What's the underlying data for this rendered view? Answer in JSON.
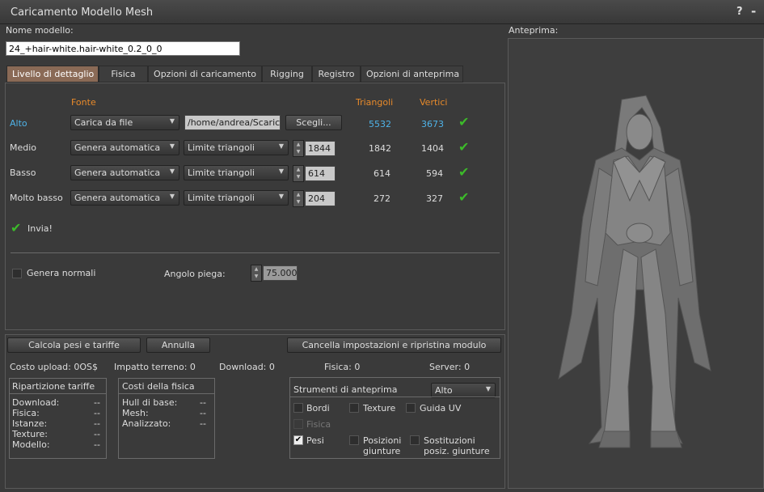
{
  "window": {
    "title": "Caricamento Modello Mesh",
    "help": "?",
    "close": "-"
  },
  "model_name": {
    "label": "Nome modello:",
    "value": "24_+hair-white.hair-white_0.2_0_0"
  },
  "tabs": [
    {
      "label": "Livello di dettaglio",
      "active": true
    },
    {
      "label": "Fisica"
    },
    {
      "label": "Opzioni di caricamento"
    },
    {
      "label": "Rigging"
    },
    {
      "label": "Registro"
    },
    {
      "label": "Opzioni di anteprima"
    }
  ],
  "lod": {
    "headers": {
      "source": "Fonte",
      "triangles": "Triangoli",
      "vertices": "Vertici"
    },
    "rows": [
      {
        "name": "Alto",
        "source": "Carica da file",
        "file": "/home/andrea/Scaric",
        "browse": "Scegli...",
        "triangles": "5532",
        "vertices": "3673",
        "highlight": true
      },
      {
        "name": "Medio",
        "source": "Genera automatica",
        "mode": "Limite triangoli",
        "limit": "1844",
        "triangles": "1842",
        "vertices": "1404"
      },
      {
        "name": "Basso",
        "source": "Genera automatica",
        "mode": "Limite triangoli",
        "limit": "614",
        "triangles": "614",
        "vertices": "594"
      },
      {
        "name": "Molto basso",
        "source": "Genera automatica",
        "mode": "Limite triangoli",
        "limit": "204",
        "triangles": "272",
        "vertices": "327"
      }
    ],
    "status": "Invia!",
    "generate_normals": "Genera normali",
    "crease_angle_label": "Angolo piega:",
    "crease_angle": "75.000"
  },
  "buttons": {
    "calculate": "Calcola pesi e tariffe",
    "cancel": "Annulla",
    "reset": "Cancella impostazioni e ripristina modulo"
  },
  "costs": {
    "upload": "Costo upload: 0OS$",
    "land": "Impatto terreno: 0",
    "download": "Download: 0",
    "physics": "Fisica: 0",
    "server": "Server: 0"
  },
  "fee_breakdown": {
    "title": "Ripartizione tariffe",
    "items": [
      {
        "label": "Download:",
        "value": "--"
      },
      {
        "label": "Fisica:",
        "value": "--"
      },
      {
        "label": "Istanze:",
        "value": "--"
      },
      {
        "label": "Texture:",
        "value": "--"
      },
      {
        "label": "Modello:",
        "value": "--"
      }
    ]
  },
  "physics_costs": {
    "title": "Costi della fisica",
    "items": [
      {
        "label": "Hull di base:",
        "value": "--"
      },
      {
        "label": "Mesh:",
        "value": "--"
      },
      {
        "label": "Analizzato:",
        "value": "--"
      }
    ]
  },
  "preview_tools": {
    "title": "Strumenti di anteprima",
    "level": "Alto",
    "edges": "Bordi",
    "texture": "Texture",
    "uv_guide": "Guida UV",
    "physics": "Fisica",
    "weights": "Pesi",
    "joint_positions": "Posizioni giunture",
    "joint_overrides": "Sostituzioni posiz. giunture"
  },
  "preview": {
    "label": "Anteprima:"
  },
  "colors": {
    "accent_orange": "#e88a2a",
    "accent_blue": "#4fb3e8",
    "active_tab": "#8a6a56",
    "check_green": "#3cba2a"
  }
}
